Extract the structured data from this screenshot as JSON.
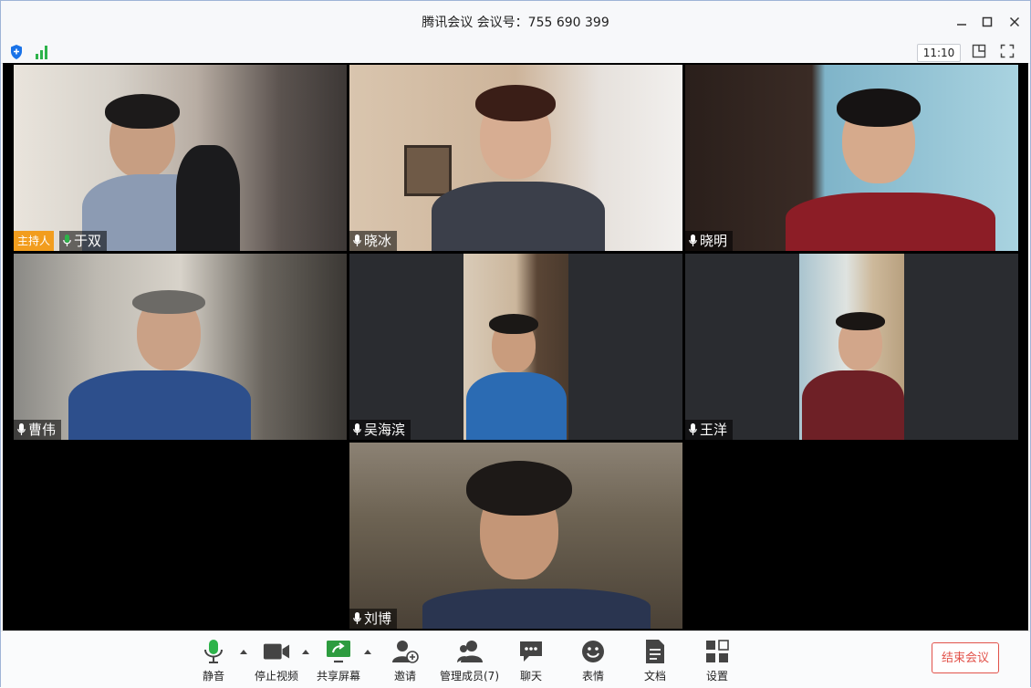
{
  "window": {
    "title": "腾讯会议 会议号：755 690 399"
  },
  "status": {
    "time": "11:10",
    "colors": {
      "shield": "#1a73e8",
      "signal": "#2db34a"
    }
  },
  "participants": [
    {
      "name": "于双",
      "host_label": "主持人",
      "is_host": true
    },
    {
      "name": "晓冰"
    },
    {
      "name": "晓明"
    },
    {
      "name": "曹伟"
    },
    {
      "name": "吴海滨"
    },
    {
      "name": "王洋"
    },
    {
      "name": "刘博"
    }
  ],
  "toolbar": {
    "mute_label": "静音",
    "stop_video_label": "停止视频",
    "share_label": "共享屏幕",
    "invite_label": "邀请",
    "manage_label": "管理成员(7)",
    "chat_label": "聊天",
    "reactions_label": "表情",
    "docs_label": "文档",
    "settings_label": "设置",
    "end_label": "结束会议",
    "colors": {
      "mic_active": "#2db34a",
      "share": "#2d9c3f",
      "end": "#e2524a",
      "icon": "#444444"
    }
  }
}
